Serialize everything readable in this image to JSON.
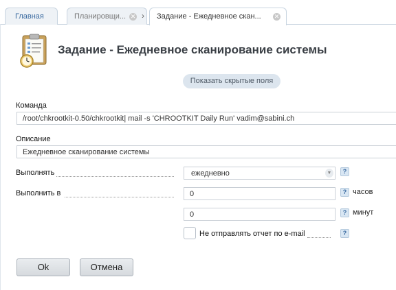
{
  "tabs": {
    "home": "Главная",
    "scheduler": "Планировщи...",
    "active": "Задание - Ежедневное скан..."
  },
  "page": {
    "title": "Задание - Ежедневное сканирование системы",
    "show_hidden_label": "Показать скрытые поля"
  },
  "form": {
    "command_label": "Команда",
    "command_value": "/root/chkrootkit-0.50/chkrootkit| mail -s 'CHROOTKIT Daily Run' vadim@sabini.ch",
    "description_label": "Описание",
    "description_value": "Ежедневное сканирование системы",
    "run_label": "Выполнять",
    "run_value": "ежедневно",
    "run_at_label": "Выполнить в",
    "hours_value": "0",
    "hours_unit": "часов",
    "minutes_value": "0",
    "minutes_unit": "минут",
    "no_email_label": "Не отправлять отчет по e-mail",
    "help_glyph": "?"
  },
  "buttons": {
    "ok": "Ok",
    "cancel": "Отмена"
  }
}
